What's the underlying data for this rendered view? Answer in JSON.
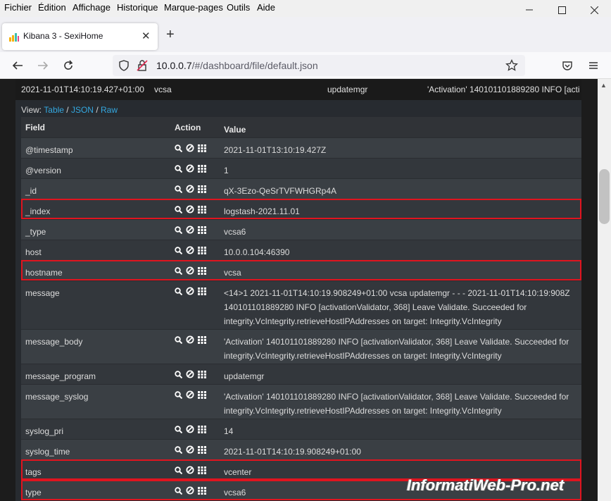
{
  "menu": [
    "Fichier",
    "Édition",
    "Affichage",
    "Historique",
    "Marque-pages",
    "Outils",
    "Aide"
  ],
  "tab": {
    "title": "Kibana 3 - SexiHome"
  },
  "url": {
    "host": "10.0.0.7",
    "path": "/#/dashboard/file/default.json"
  },
  "summary": {
    "timestamp": "2021-11-01T14:10:19.427+01:00",
    "hostname": "vcsa",
    "program": "updatemgr",
    "message": "'Activation' 140101101889280 INFO  [acti"
  },
  "view": {
    "label": "View:",
    "table": "Table",
    "sep1": " / ",
    "json": "JSON",
    "sep2": " / ",
    "raw": "Raw"
  },
  "table": {
    "headers": {
      "field": "Field",
      "action": "Action",
      "value": "Value"
    },
    "rows": [
      {
        "field": "@timestamp",
        "value": "2021-11-01T13:10:19.427Z"
      },
      {
        "field": "@version",
        "value": "1"
      },
      {
        "field": "_id",
        "value": "qX-3Ezo-QeSrTVFWHGRp4A"
      },
      {
        "field": "_index",
        "value": "logstash-2021.11.01"
      },
      {
        "field": "_type",
        "value": "vcsa6"
      },
      {
        "field": "host",
        "value": "10.0.0.104:46390"
      },
      {
        "field": "hostname",
        "value": "vcsa"
      },
      {
        "field": "message",
        "value": "<14>1 2021-11-01T14:10:19.908249+01:00 vcsa updatemgr - - -  2021-11-01T14:10:19:908Z 140101101889280 INFO  [activationValidator, 368] Leave Validate. Succeeded for integrity.VcIntegrity.retrieveHostIPAddresses on target: Integrity.VcIntegrity"
      },
      {
        "field": "message_body",
        "value": "'Activation' 140101101889280 INFO  [activationValidator, 368] Leave Validate. Succeeded for integrity.VcIntegrity.retrieveHostIPAddresses on target: Integrity.VcIntegrity"
      },
      {
        "field": "message_program",
        "value": "updatemgr"
      },
      {
        "field": "message_syslog",
        "value": "'Activation' 140101101889280 INFO  [activationValidator, 368] Leave Validate. Succeeded for integrity.VcIntegrity.retrieveHostIPAddresses on target: Integrity.VcIntegrity"
      },
      {
        "field": "syslog_pri",
        "value": "14"
      },
      {
        "field": "syslog_time",
        "value": "2021-11-01T14:10:19.908249+01:00"
      },
      {
        "field": "tags",
        "value": "vcenter"
      },
      {
        "field": "type",
        "value": "vcsa6"
      }
    ]
  },
  "watermark": "InformatiWeb-Pro.net",
  "colors": {
    "highlight": "#e0141f",
    "link": "#34a8e0"
  }
}
